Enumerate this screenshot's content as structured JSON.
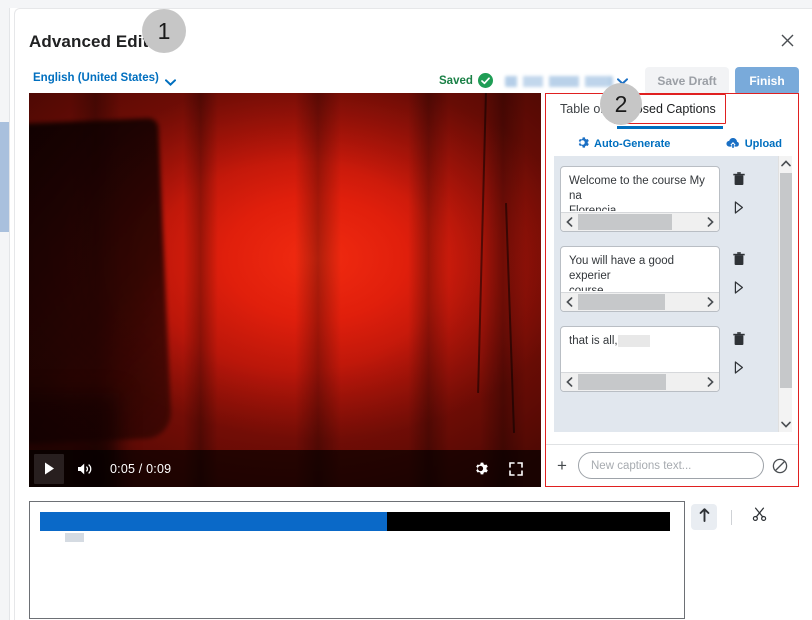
{
  "window": {
    "title": "Advanced Editing",
    "close_icon": "close-icon"
  },
  "subbar": {
    "language": "English (United States)",
    "language_chevron_icon": "chevron-down-icon",
    "saved_label": "Saved",
    "saved_check_icon": "check-circle-icon",
    "redacted_select_value": "",
    "redacted_chevron_icon": "chevron-down-icon",
    "save_draft_label": "Save Draft",
    "finish_label": "Finish"
  },
  "video": {
    "play_icon": "play-icon",
    "volume_icon": "volume-icon",
    "time_display": "0:05 / 0:09",
    "current_time": "0:05",
    "duration": "0:09",
    "settings_icon": "gear-icon",
    "fullscreen_icon": "fullscreen-icon"
  },
  "captions_panel": {
    "tabs": [
      {
        "label": "Table of Contents",
        "short": "Table of Co",
        "active": false
      },
      {
        "label": "Closed Captions",
        "short": "Closed Captions",
        "active": true
      }
    ],
    "actions": [
      {
        "label": "Auto-Generate",
        "icon": "auto-generate-icon"
      },
      {
        "label": "Upload",
        "icon": "cloud-upload-icon"
      }
    ],
    "captions": [
      {
        "text": "Welcome to the course My na",
        "text_line2": "Florencia.",
        "selected_text": "",
        "delete_icon": "trash-icon",
        "play_icon": "play-triangle-icon",
        "hscroll_left_icon": "chevron-left-icon",
        "hscroll_right_icon": "chevron-right-icon"
      },
      {
        "text": "You will have a good experier",
        "text_line2": "course,",
        "selected_text": "",
        "delete_icon": "trash-icon",
        "play_icon": "play-triangle-icon",
        "hscroll_left_icon": "chevron-left-icon",
        "hscroll_right_icon": "chevron-right-icon"
      },
      {
        "text": "that is all,",
        "text_line2": "",
        "selected_text": "          ",
        "delete_icon": "trash-icon",
        "play_icon": "play-triangle-icon",
        "hscroll_left_icon": "chevron-left-icon",
        "hscroll_right_icon": "chevron-right-icon"
      }
    ],
    "vscroll_up_icon": "chevron-up-icon",
    "vscroll_down_icon": "chevron-down-icon",
    "new_caption": {
      "add_icon": "plus-icon",
      "placeholder": "New captions text...",
      "value": "",
      "disable_icon": "block-icon"
    }
  },
  "timeline": {
    "played_percent": 55,
    "remaining_percent": 45,
    "tools": [
      {
        "label": "",
        "icon": "arrow-up-icon",
        "name": "trim-button"
      },
      {
        "label": "",
        "icon": "scissors-icon",
        "name": "cut-button"
      }
    ]
  },
  "callouts": [
    {
      "number": "1"
    },
    {
      "number": "2"
    }
  ],
  "colors": {
    "accent_blue": "#006fbf",
    "finish_button": "#79aada",
    "timeline_blue": "#0a69c8",
    "highlight_red": "#e02020",
    "saved_green": "#1a8046"
  }
}
